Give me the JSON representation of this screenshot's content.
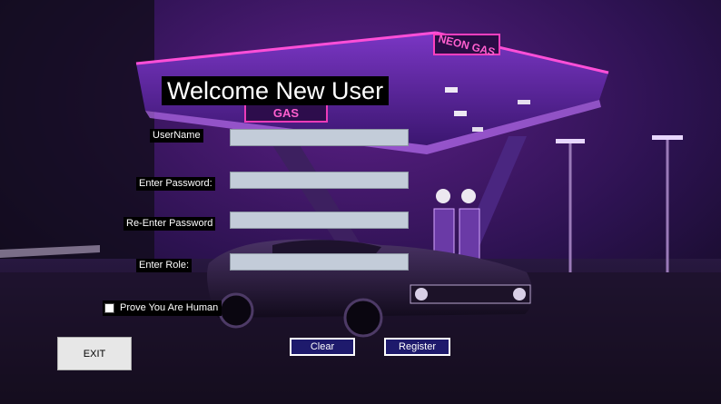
{
  "window": {
    "title": "Welcome New User",
    "accent_color": "#1e1a6c",
    "field_color": "#c3ccd9"
  },
  "form": {
    "username_label": "UserName",
    "username_value": "",
    "password_label": "Enter Password:",
    "password_value": "",
    "reenter_label": "Re-Enter Password",
    "reenter_value": "",
    "role_label": "Enter Role:",
    "role_value": "",
    "human_check_label": "Prove You Are Human",
    "human_checked": false
  },
  "buttons": {
    "exit": "EXIT",
    "clear": "Clear",
    "register": "Register"
  },
  "background": {
    "sign_text": "NEON GAS",
    "canopy_text": "GAS"
  }
}
